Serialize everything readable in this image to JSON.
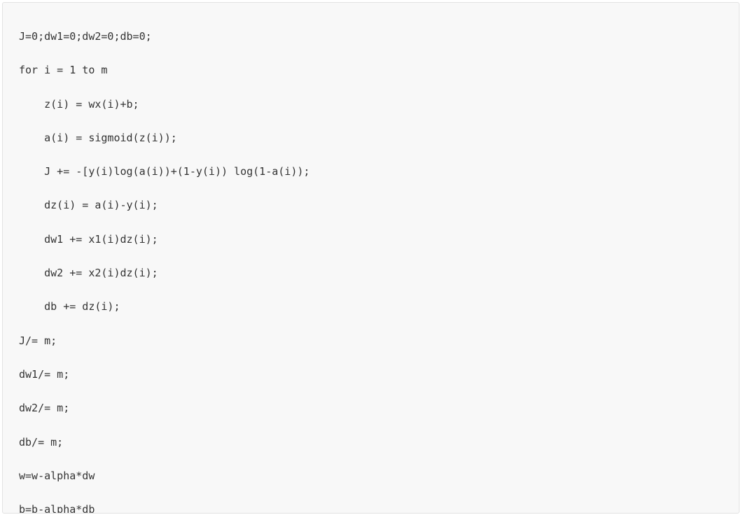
{
  "code": {
    "lines": [
      "J=0;dw1=0;dw2=0;db=0;",
      "for i = 1 to m",
      "    z(i) = wx(i)+b;",
      "    a(i) = sigmoid(z(i));",
      "    J += -[y(i)log(a(i))+(1-y(i)) log(1-a(i));",
      "    dz(i) = a(i)-y(i);",
      "    dw1 += x1(i)dz(i);",
      "    dw2 += x2(i)dz(i);",
      "    db += dz(i);",
      "J/= m;",
      "dw1/= m;",
      "dw2/= m;",
      "db/= m;",
      "w=w-alpha*dw",
      "b=b-alpha*db"
    ]
  }
}
